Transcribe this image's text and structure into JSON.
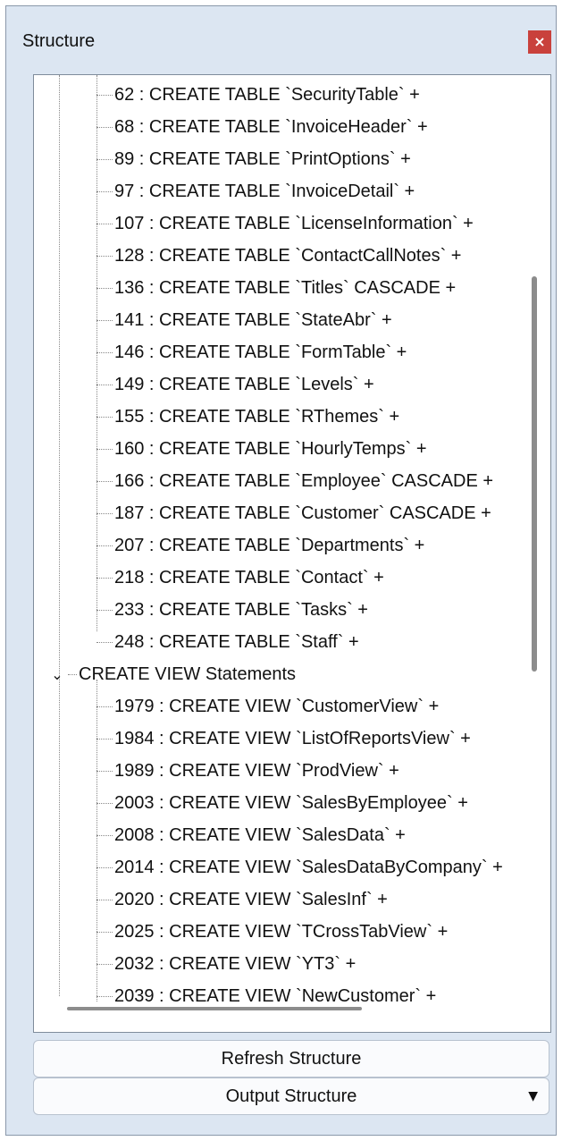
{
  "panel": {
    "title": "Structure",
    "close_glyph": "×"
  },
  "tree": {
    "table_rows": [
      "62 : CREATE TABLE `SecurityTable` +",
      "68 : CREATE TABLE `InvoiceHeader` +",
      "89 : CREATE TABLE `PrintOptions` +",
      "97 : CREATE TABLE `InvoiceDetail` +",
      "107 : CREATE TABLE `LicenseInformation` +",
      "128 : CREATE TABLE `ContactCallNotes` +",
      "136 : CREATE TABLE `Titles` CASCADE  +",
      "141 : CREATE TABLE `StateAbr` +",
      "146 : CREATE TABLE `FormTable` +",
      "149 : CREATE TABLE `Levels` +",
      "155 : CREATE TABLE `RThemes` +",
      "160 : CREATE TABLE `HourlyTemps` +",
      "166 : CREATE TABLE `Employee` CASCADE  +",
      "187 : CREATE TABLE `Customer` CASCADE  +",
      "207 : CREATE TABLE `Departments` +",
      "218 : CREATE TABLE `Contact` +",
      "233 : CREATE TABLE `Tasks` +",
      "248 : CREATE TABLE `Staff` +"
    ],
    "view_group": {
      "chevron": "⌄",
      "label": "CREATE VIEW Statements"
    },
    "view_rows": [
      "1979 : CREATE VIEW `CustomerView` +",
      "1984 : CREATE VIEW `ListOfReportsView` +",
      "1989 : CREATE VIEW `ProdView` +",
      "2003 : CREATE VIEW `SalesByEmployee` +",
      "2008 : CREATE VIEW `SalesData` +",
      "2014 : CREATE VIEW `SalesDataByCompany` +",
      "2020 : CREATE VIEW `SalesInf` +",
      "2025 : CREATE VIEW `TCrossTabView` +",
      "2032 : CREATE VIEW `YT3` +",
      "2039 : CREATE VIEW `NewCustomer` +"
    ]
  },
  "buttons": {
    "refresh_label": "Refresh Structure",
    "output_label": "Output Structure",
    "output_arrow": "▼"
  }
}
